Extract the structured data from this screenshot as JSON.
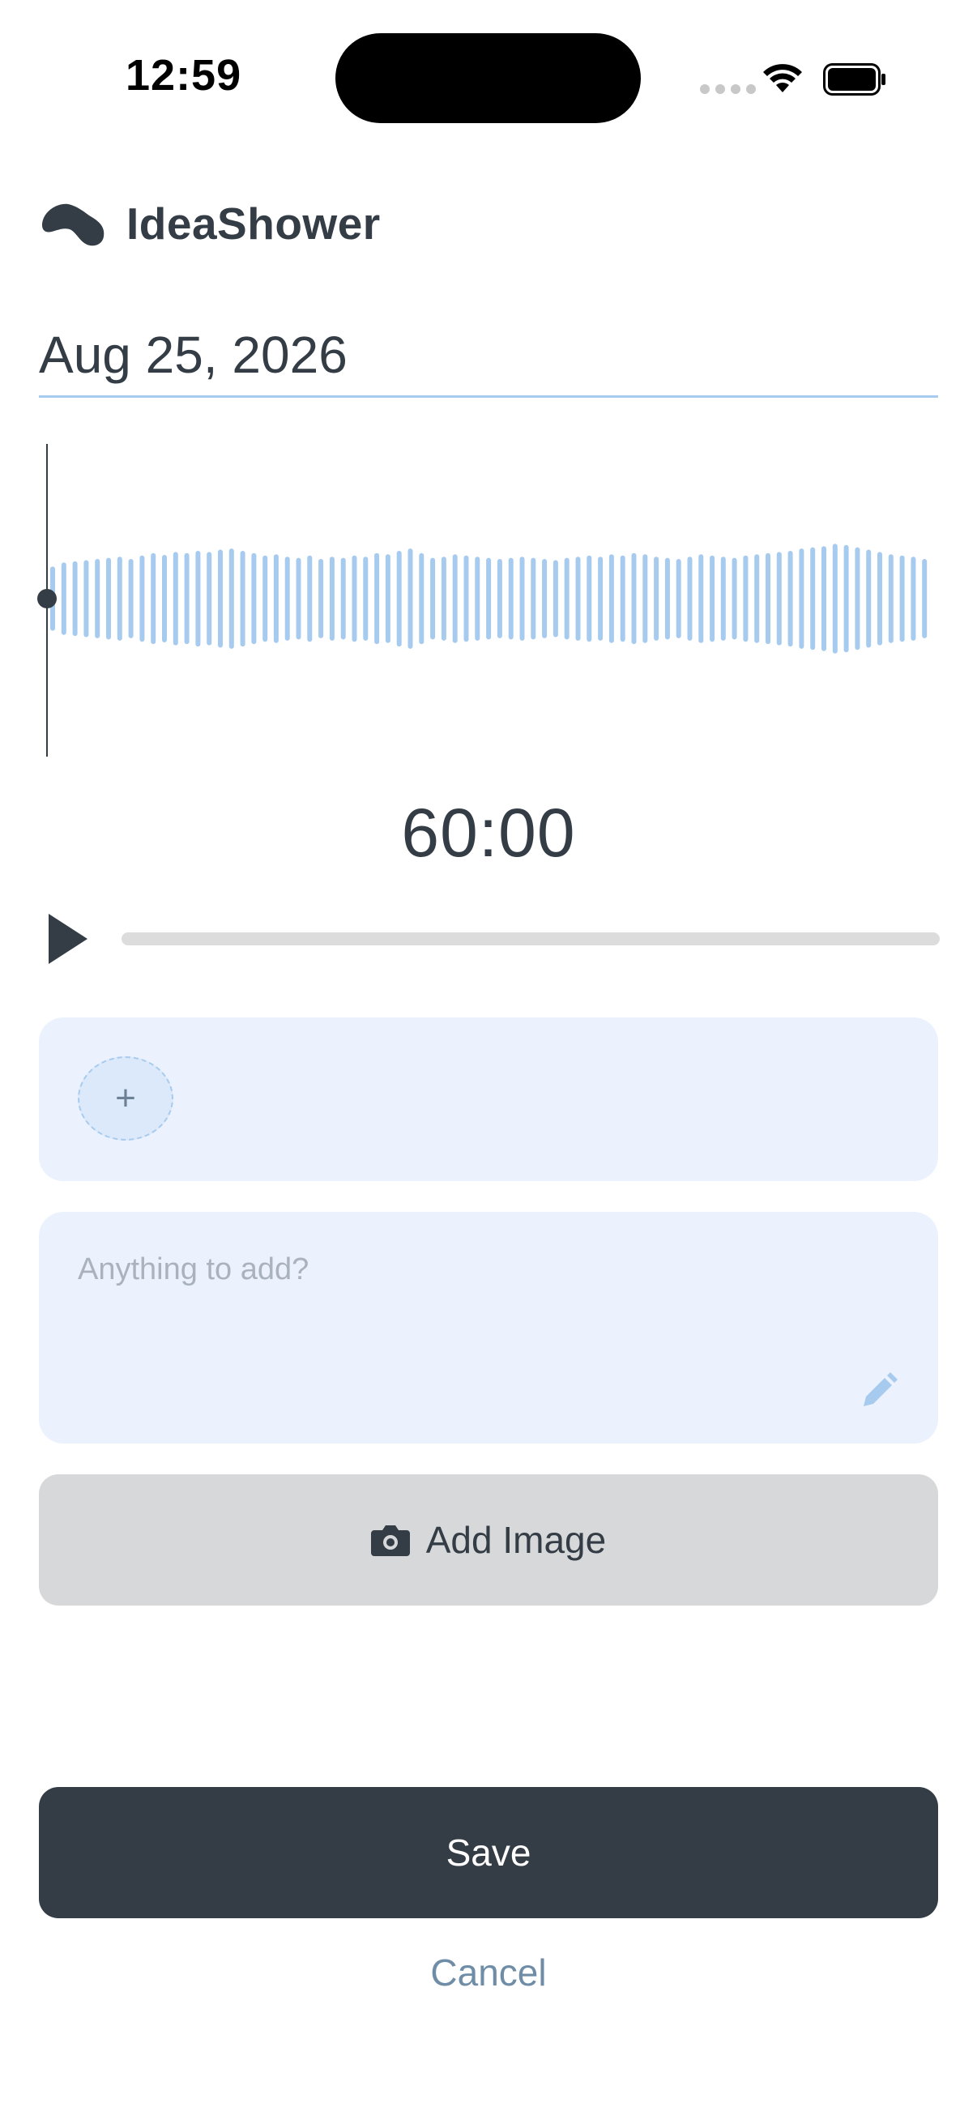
{
  "status_bar": {
    "time": "12:59"
  },
  "header": {
    "app_name": "IdeaShower"
  },
  "recording": {
    "date": "Aug 25, 2026",
    "duration": "60:00",
    "waveform_levels": [
      0.55,
      0.62,
      0.64,
      0.66,
      0.68,
      0.7,
      0.72,
      0.68,
      0.74,
      0.78,
      0.75,
      0.8,
      0.78,
      0.82,
      0.8,
      0.84,
      0.86,
      0.82,
      0.78,
      0.74,
      0.76,
      0.72,
      0.7,
      0.74,
      0.68,
      0.72,
      0.7,
      0.74,
      0.72,
      0.78,
      0.76,
      0.82,
      0.86,
      0.78,
      0.7,
      0.72,
      0.76,
      0.74,
      0.72,
      0.7,
      0.68,
      0.7,
      0.72,
      0.7,
      0.68,
      0.66,
      0.7,
      0.72,
      0.74,
      0.72,
      0.76,
      0.74,
      0.78,
      0.76,
      0.72,
      0.7,
      0.68,
      0.72,
      0.76,
      0.74,
      0.72,
      0.7,
      0.74,
      0.76,
      0.78,
      0.8,
      0.82,
      0.86,
      0.88,
      0.9,
      0.94,
      0.92,
      0.88,
      0.84,
      0.8,
      0.76,
      0.74,
      0.72,
      0.68
    ],
    "playback_progress": 0
  },
  "tags": {
    "add_symbol": "+"
  },
  "notes": {
    "placeholder": "Anything to add?"
  },
  "actions": {
    "add_image_label": "Add Image",
    "save_label": "Save",
    "cancel_label": "Cancel"
  },
  "colors": {
    "primary": "#343d46",
    "waveform": "#a7cbee",
    "card_bg": "#ebf2fd",
    "cancel": "#6f8da6"
  },
  "icons": [
    "logo-icon",
    "signal-icon",
    "wifi-icon",
    "battery-icon",
    "play-icon",
    "plus-icon",
    "pencil-icon",
    "camera-icon"
  ]
}
